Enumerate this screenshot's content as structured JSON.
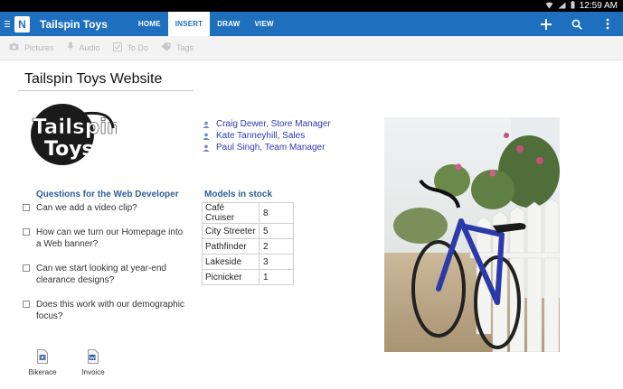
{
  "status_bar": {
    "time": "12:59 AM"
  },
  "app_bar": {
    "notebook_title": "Tailspin Toys",
    "logo_letter": "N",
    "tabs": [
      {
        "label": "HOME",
        "active": false
      },
      {
        "label": "INSERT",
        "active": true
      },
      {
        "label": "DRAW",
        "active": false
      },
      {
        "label": "VIEW",
        "active": false
      }
    ],
    "actions": [
      "plus-icon",
      "search-icon",
      "more-vertical-icon"
    ]
  },
  "ribbon": {
    "items": [
      {
        "label": "Pictures",
        "icon": "camera-icon"
      },
      {
        "label": "Audio",
        "icon": "microphone-icon"
      },
      {
        "label": "To Do",
        "icon": "checkbox-icon"
      },
      {
        "label": "Tags",
        "icon": "tag-icon"
      }
    ]
  },
  "page": {
    "title": "Tailspin Toys Website",
    "brand_logo_text": [
      "Tailspin",
      "Toys"
    ],
    "people": [
      "Craig Dewer, Store Manager",
      "Kate Tanneyhill, Sales",
      "Paul Singh, Team Manager"
    ],
    "questions_heading": "Questions for the Web Developer",
    "questions": [
      "Can we add a video clip?",
      "How can we turn our Homepage into a Web banner?",
      "Can we start looking at year-end clearance designs?",
      "Does this work with our demographic focus?"
    ],
    "models_heading": "Models in stock",
    "models": [
      {
        "name": "Café Cruiser",
        "qty": "8"
      },
      {
        "name": "City Streeter",
        "qty": "5"
      },
      {
        "name": "Pathfinder",
        "qty": "2"
      },
      {
        "name": "Lakeside",
        "qty": "3"
      },
      {
        "name": "Picnicker",
        "qty": "1"
      }
    ],
    "attachments": [
      {
        "label": "Bikerace",
        "icon": "video-file-icon"
      },
      {
        "label": "Invoice",
        "icon": "word-document-icon"
      }
    ]
  },
  "colors": {
    "app_bar": "#1f6fbf",
    "heading": "#2e5f97",
    "link": "#2f3bb0"
  }
}
